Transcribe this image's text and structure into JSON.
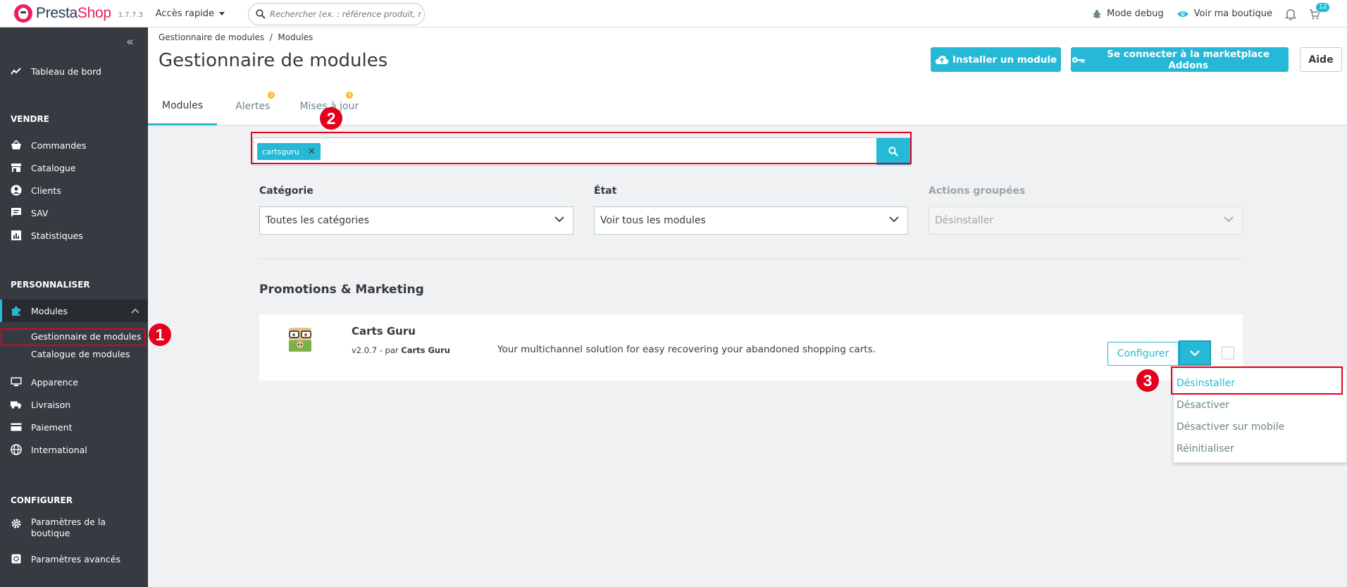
{
  "header": {
    "logo_presta": "Presta",
    "logo_shop": "Shop",
    "version": "1.7.7.3",
    "quick_access": "Accès rapide",
    "search_placeholder": "Rechercher (ex. : référence produit, nom",
    "debug_mode": "Mode debug",
    "view_shop": "Voir ma boutique",
    "notifications_count": "12"
  },
  "sidebar": {
    "dashboard": "Tableau de bord",
    "section_sell": "VENDRE",
    "orders": "Commandes",
    "catalog": "Catalogue",
    "customers": "Clients",
    "service": "SAV",
    "stats": "Statistiques",
    "section_customize": "PERSONNALISER",
    "modules": "Modules",
    "module_manager": "Gestionnaire de modules",
    "module_catalog": "Catalogue de modules",
    "design": "Apparence",
    "shipping": "Livraison",
    "payment": "Paiement",
    "international": "International",
    "section_configure": "CONFIGURER",
    "shop_params_1": "Paramètres de la",
    "shop_params_2": "boutique",
    "advanced_params": "Paramètres avancés"
  },
  "page": {
    "breadcrumb": "Gestionnaire de modules  /  Modules",
    "title": "Gestionnaire de modules",
    "btn_install": "Installer un module",
    "btn_connect": "Se connecter à la marketplace Addons",
    "btn_help": "Aide",
    "tabs": [
      {
        "label": "Modules",
        "badge": ""
      },
      {
        "label": "Alertes",
        "badge": "3"
      },
      {
        "label": "Mises à jour",
        "badge": "6"
      }
    ]
  },
  "filters": {
    "search_tag": "cartsguru",
    "category_label": "Catégorie",
    "category_value": "Toutes les catégories",
    "state_label": "État",
    "state_value": "Voir tous les modules",
    "bulk_label": "Actions groupées",
    "bulk_value": "Désinstaller"
  },
  "category_title": "Promotions & Marketing",
  "module": {
    "name": "Carts Guru",
    "version": "v2.0.7 - par ",
    "author": "Carts Guru",
    "description": "Your multichannel solution for easy recovering your abandoned shopping carts.",
    "btn_configure": "Configurer"
  },
  "dropdown_items": [
    "Désinstaller",
    "Désactiver",
    "Désactiver sur mobile",
    "Réinitialiser"
  ],
  "annotations": [
    "1",
    "2",
    "3"
  ],
  "colors": {
    "accent": "#25b9d7",
    "sidebar": "#363a41",
    "annotation": "#e5001e",
    "brand": "#ed1d61"
  }
}
